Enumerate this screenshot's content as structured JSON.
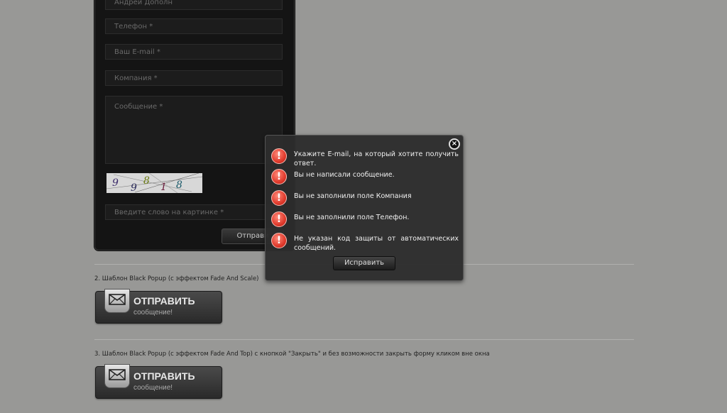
{
  "form": {
    "name_placeholder": "Андрей Дополн",
    "phone_placeholder": "Телефон *",
    "email_placeholder": "Ваш E-mail *",
    "company_placeholder": "Компания *",
    "message_placeholder": "Сообщение *",
    "captcha_text": "99818",
    "captcha_placeholder": "Введите слово на картинке *",
    "submit_label": "Отправи"
  },
  "sections": [
    {
      "label": "2. Шаблон Black Popup (с эффектом Fade And Scale)"
    },
    {
      "label": "3. Шаблон Black Popup (с эффектом Fade And Top) с кнопкой \"Закрыть\" и без возможности закрыть форму кликом вне окна"
    }
  ],
  "send_button": {
    "title": "ОТПРАВИТЬ",
    "subtitle": "сообщение!"
  },
  "popup": {
    "close_icon": "close-icon",
    "errors": [
      "Укажите E-mail, на который хотите получить ответ.",
      "Вы не написали сообщение.",
      "Вы не заполнили поле Компания",
      "Вы не заполнили поле Телефон.",
      "Не указан код защиты от автоматических сообщений."
    ],
    "fix_label": "Исправить"
  },
  "colors": {
    "background": "#989896",
    "panel": "#141414",
    "error_icon": "#e03a2c"
  }
}
